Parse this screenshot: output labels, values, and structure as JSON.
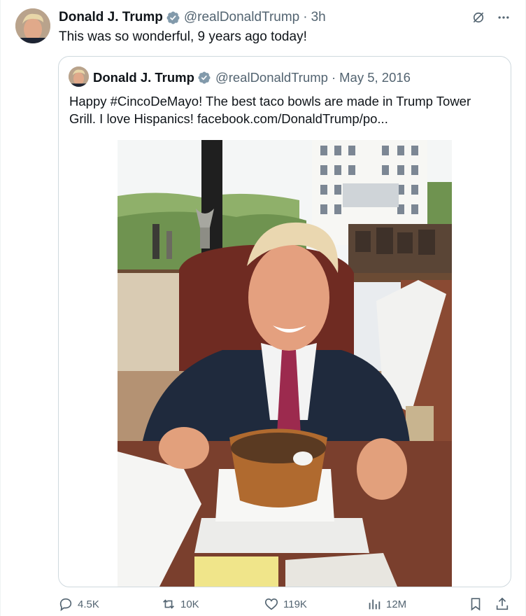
{
  "tweet": {
    "author_name": "Donald J. Trump",
    "handle": "@realDonaldTrump",
    "separator": "·",
    "time": "3h",
    "text": "This was so wonderful, 9 years ago today!"
  },
  "quoted": {
    "author_name": "Donald J. Trump",
    "handle": "@realDonaldTrump",
    "separator": "·",
    "date": "May 5, 2016",
    "text": "Happy #CincoDeMayo! The best taco bowls are made in Trump Tower Grill. I love Hispanics! facebook.com/DonaldTrump/po..."
  },
  "metrics": {
    "replies": "4.5K",
    "reposts": "10K",
    "likes": "119K",
    "views": "12M"
  },
  "colors": {
    "verified": "#829aab",
    "muted": "#536471",
    "border": "#cfd9de"
  },
  "icons": [
    "verified-badge-icon",
    "grok-icon",
    "more-icon",
    "reply-icon",
    "repost-icon",
    "like-icon",
    "views-icon",
    "bookmark-icon",
    "share-icon"
  ]
}
